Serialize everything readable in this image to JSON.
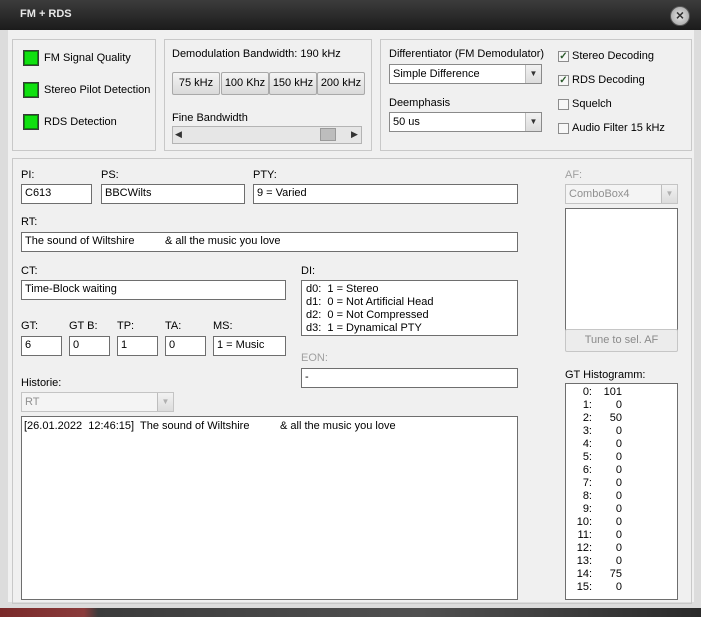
{
  "window": {
    "title": "FM + RDS"
  },
  "signal": {
    "items": [
      {
        "label": "FM Signal Quality",
        "color": "#10e010"
      },
      {
        "label": "Stereo Pilot Detection",
        "color": "#10e010"
      },
      {
        "label": "RDS Detection",
        "color": "#10e010"
      }
    ]
  },
  "demod": {
    "label": "Demodulation Bandwidth: 190 kHz",
    "buttons": [
      "75 kHz",
      "100 Khz",
      "150 kHz",
      "200 kHz"
    ],
    "fine_label": "Fine Bandwidth"
  },
  "diff": {
    "label": "Differentiator (FM Demodulator)",
    "value": "Simple Difference",
    "deemph_label": "Deemphasis",
    "deemph_value": "50 us"
  },
  "checks": [
    {
      "label": "Stereo Decoding",
      "checked": true
    },
    {
      "label": "RDS Decoding",
      "checked": true
    },
    {
      "label": "Squelch",
      "checked": false
    },
    {
      "label": "Audio Filter 15 kHz",
      "checked": false
    }
  ],
  "rds": {
    "pi_label": "PI:",
    "pi": "C613",
    "ps_label": "PS:",
    "ps": "BBCWilts",
    "pty_label": "PTY:",
    "pty": "9 = Varied",
    "rt_label": "RT:",
    "rt": "The sound of Wiltshire          & all the music you love",
    "ct_label": "CT:",
    "ct": "Time-Block waiting",
    "di_label": "DI:",
    "di_lines": [
      "d0:  1 = Stereo",
      "d1:  0 = Not Artificial Head",
      "d2:  0 = Not Compressed",
      "d3:  1 = Dynamical PTY"
    ],
    "gt_label": "GT:",
    "gt": "6",
    "gtb_label": "GT B:",
    "gtb": "0",
    "tp_label": "TP:",
    "tp": "1",
    "ta_label": "TA:",
    "ta": "0",
    "ms_label": "MS:",
    "ms": "1 = Music",
    "eon_label": "EON:",
    "eon": "-",
    "historie_label": "Historie:",
    "historie_select": "RT",
    "history_entries": [
      "[26.01.2022  12:46:15]  The sound of Wiltshire          & all the music you love"
    ]
  },
  "af": {
    "label": "AF:",
    "combo": "ComboBox4",
    "tune_button": "Tune to sel. AF",
    "hist_label": "GT Histogramm:",
    "histogram": [
      {
        "k": "0:",
        "v": "101"
      },
      {
        "k": "1:",
        "v": "0"
      },
      {
        "k": "2:",
        "v": "50"
      },
      {
        "k": "3:",
        "v": "0"
      },
      {
        "k": "4:",
        "v": "0"
      },
      {
        "k": "5:",
        "v": "0"
      },
      {
        "k": "6:",
        "v": "0"
      },
      {
        "k": "7:",
        "v": "0"
      },
      {
        "k": "8:",
        "v": "0"
      },
      {
        "k": "9:",
        "v": "0"
      },
      {
        "k": "10:",
        "v": "0"
      },
      {
        "k": "11:",
        "v": "0"
      },
      {
        "k": "12:",
        "v": "0"
      },
      {
        "k": "13:",
        "v": "0"
      },
      {
        "k": "14:",
        "v": "75"
      },
      {
        "k": "15:",
        "v": "0"
      }
    ]
  }
}
